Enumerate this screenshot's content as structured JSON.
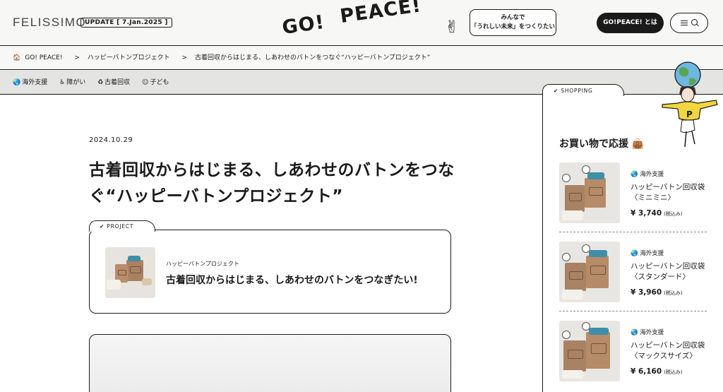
{
  "header": {
    "brand": "FELISSIMO",
    "update_label": "UPDATE [ 7.Jan.2025 ]",
    "logo_word1": "GO!",
    "logo_word2": "PEACE!",
    "bubble_line1": "みんなで",
    "bubble_line2": "「うれしい未来」をつくりたい",
    "about_button": "GO!PEACE! とは"
  },
  "breadcrumb": {
    "home": "GO! PEACE!",
    "sep": ">",
    "level2": "ハッピーバトンプロジェクト",
    "level3": "古着回収からはじまる、しあわせのバトンをつなぐ“ハッピーバトンプロジェクト”"
  },
  "tags": [
    {
      "label": "海外支援",
      "icon": "globe-icon"
    },
    {
      "label": "障がい",
      "icon": "accessibility-icon"
    },
    {
      "label": "古着回収",
      "icon": "recycle-icon"
    },
    {
      "label": "子ども",
      "icon": "child-icon"
    }
  ],
  "article": {
    "date": "2024.10.29",
    "title": "古着回収からはじまる、しあわせのバトンをつなぐ“ハッピーバトンプロジェクト”"
  },
  "project": {
    "tab_label": "PROJECT",
    "small_label": "ハッピーバトンプロジェクト",
    "title": "古着回収からはじまる、しあわせのバトンをつなぎたい!"
  },
  "sidebar": {
    "tab_label": "SHOPPING",
    "title": "お買い物で応援",
    "items": [
      {
        "tag": "海外支援",
        "name_line1": "ハッピーバトン回収袋",
        "name_line2": "〈ミニミニ〉",
        "price": "¥ 3,740",
        "tax": "(税込み)"
      },
      {
        "tag": "海外支援",
        "name_line1": "ハッピーバトン回収袋",
        "name_line2": "〈スタンダード〉",
        "price": "¥ 3,960",
        "tax": "(税込み)"
      },
      {
        "tag": "海外支援",
        "name_line1": "ハッピーバトン回収袋",
        "name_line2": "〈マックスサイズ〉",
        "price": "¥ 6,160",
        "tax": "(税込み)"
      }
    ]
  },
  "colors": {
    "ink": "#1a1a1a",
    "background": "#f7f7f5",
    "tagbar": "#e4e4e2",
    "mascot_shirt": "#f2d63f"
  }
}
